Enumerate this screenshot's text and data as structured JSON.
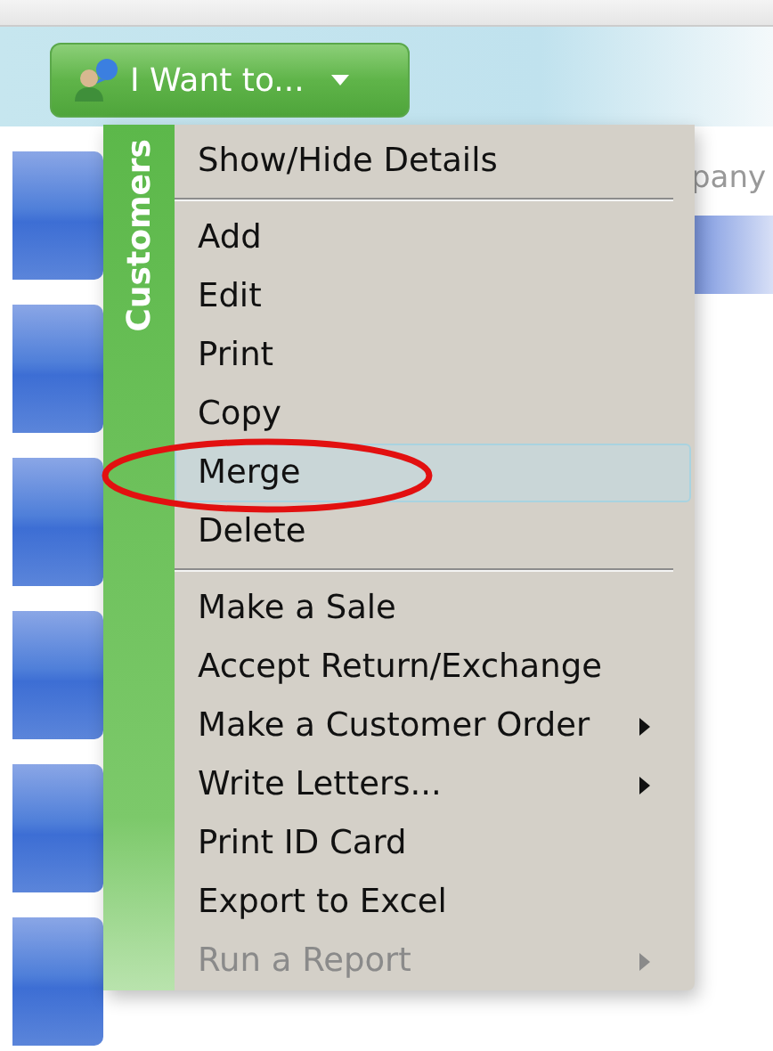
{
  "toolbar": {
    "button": {
      "label": "I Want to...",
      "dropdown": true
    }
  },
  "background": {
    "column_header": "pany"
  },
  "menu": {
    "side_label": "Customers",
    "items": [
      {
        "kind": "item",
        "label": "Show/Hide Details",
        "selected": false,
        "disabled": false,
        "submenu": false
      },
      {
        "kind": "separator"
      },
      {
        "kind": "item",
        "label": "Add",
        "selected": false,
        "disabled": false,
        "submenu": false
      },
      {
        "kind": "item",
        "label": "Edit",
        "selected": false,
        "disabled": false,
        "submenu": false
      },
      {
        "kind": "item",
        "label": "Print",
        "selected": false,
        "disabled": false,
        "submenu": false
      },
      {
        "kind": "item",
        "label": "Copy",
        "selected": false,
        "disabled": false,
        "submenu": false
      },
      {
        "kind": "item",
        "label": "Merge",
        "selected": true,
        "disabled": false,
        "submenu": false
      },
      {
        "kind": "item",
        "label": "Delete",
        "selected": false,
        "disabled": false,
        "submenu": false
      },
      {
        "kind": "separator"
      },
      {
        "kind": "item",
        "label": "Make a Sale",
        "selected": false,
        "disabled": false,
        "submenu": false
      },
      {
        "kind": "item",
        "label": "Accept Return/Exchange",
        "selected": false,
        "disabled": false,
        "submenu": false
      },
      {
        "kind": "item",
        "label": "Make a Customer Order",
        "selected": false,
        "disabled": false,
        "submenu": true
      },
      {
        "kind": "item",
        "label": "Write Letters...",
        "selected": false,
        "disabled": false,
        "submenu": true
      },
      {
        "kind": "item",
        "label": "Print ID Card",
        "selected": false,
        "disabled": false,
        "submenu": false
      },
      {
        "kind": "item",
        "label": "Export to Excel",
        "selected": false,
        "disabled": false,
        "submenu": false
      },
      {
        "kind": "item",
        "label": "Run a Report",
        "selected": false,
        "disabled": true,
        "submenu": true
      }
    ]
  }
}
